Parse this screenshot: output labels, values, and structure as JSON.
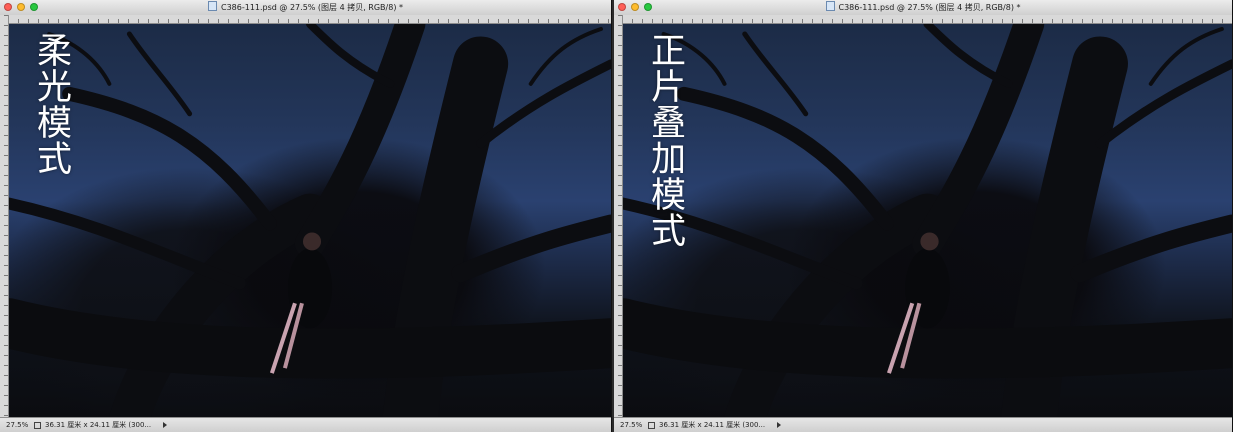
{
  "windows": [
    {
      "title": "C386-111.psd @ 27.5% (图层 4 拷贝, RGB/8) *",
      "overlay_lines": [
        "柔",
        "光",
        "模",
        "式"
      ],
      "status": {
        "zoom": "27.5%",
        "doc_info": "36.31 厘米 x 24.11 厘米 (300..."
      }
    },
    {
      "title": "C386-111.psd @ 27.5% (图层 4 拷贝, RGB/8) *",
      "overlay_lines": [
        "正",
        "片",
        "叠",
        "加",
        "模",
        "式"
      ],
      "status": {
        "zoom": "27.5%",
        "doc_info": "36.31 厘米 x 24.11 厘米 (300..."
      }
    }
  ],
  "icons": {
    "traffic_lights": [
      "close-icon",
      "minimize-icon",
      "zoom-icon"
    ],
    "doc": "document-icon",
    "export": "export-icon",
    "menu_arrow": "triangle-right-icon"
  },
  "colors": {
    "close": "#ff5f57",
    "minimize": "#febc2e",
    "zoom": "#28c840"
  }
}
